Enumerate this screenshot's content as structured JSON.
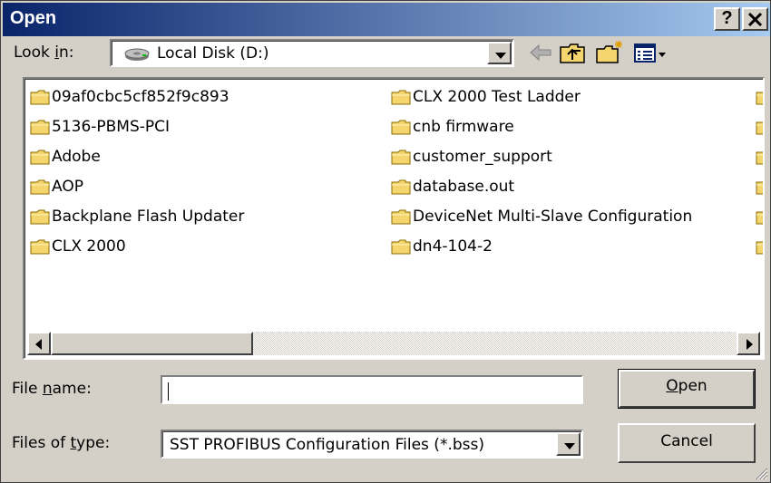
{
  "window": {
    "title": "Open",
    "help_label": "?",
    "close_label": "✕"
  },
  "look_in": {
    "label_before": "Look ",
    "label_mnemonic": "i",
    "label_after": "n:",
    "value": "Local Disk (D:)",
    "icon": "drive-icon"
  },
  "toolbar": {
    "icons": [
      "back-arrow-icon",
      "up-folder-icon",
      "new-folder-icon",
      "view-menu-icon"
    ]
  },
  "files": {
    "column1": [
      "09af0cbc5cf852f9c893",
      "5136-PBMS-PCI",
      "Adobe",
      "AOP",
      "Backplane Flash Updater",
      "CLX 2000"
    ],
    "column2": [
      "CLX 2000 Test Ladder",
      "cnb firmware",
      "customer_support",
      "database.out",
      "DeviceNet Multi-Slave Configuration",
      "dn4-104-2"
    ]
  },
  "file_name": {
    "label_before": "File ",
    "label_mnemonic": "n",
    "label_after": "ame:",
    "value": "",
    "placeholder": ""
  },
  "file_type": {
    "label_before": "Files of ",
    "label_mnemonic": "t",
    "label_after": "ype:",
    "value": "SST PROFIBUS Configuration Files (*.bss)"
  },
  "buttons": {
    "open_mnemonic": "O",
    "open_rest": "pen",
    "cancel": "Cancel"
  },
  "colors": {
    "title_start": "#0a246a",
    "title_end": "#a6caf0",
    "face": "#d4d0c8",
    "folder": "#f5d56e"
  }
}
